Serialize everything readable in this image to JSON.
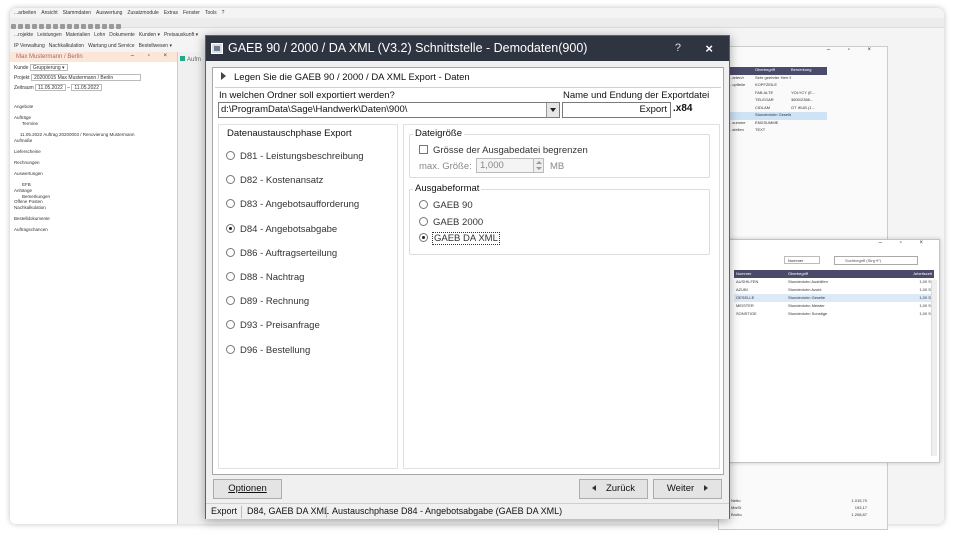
{
  "background": {
    "menubar": [
      "...arbeiten",
      "Ansicht",
      "Stammdaten",
      "Auswertung",
      "Zusatzmodule",
      "Extras",
      "Fenster",
      "Tools",
      "?"
    ],
    "ribbon1": [
      "...rojekte",
      "Leistungen",
      "Materialien",
      "Lohn",
      "Dokumente",
      "Kunden ▾",
      "Preisauskunft ▾"
    ],
    "ribbon2": [
      "IP Verwaltung",
      "Nachkalkulation",
      "Wartung und Service",
      "Bestellwesen ▾"
    ],
    "left_title": "Max Mustermann / Berlin",
    "left_rows": {
      "kunde_label": "Kunde",
      "kunde_value": "Gruppierung ▾",
      "projekt_label": "Projekt",
      "projekt_value": "20200015 Max Mustermann / Berlin",
      "zeitraum_label": "Zeitraum",
      "zeitraum_from": "11.05.2022",
      "zeitraum_to": "11.05.2022"
    },
    "tree": [
      "Angebote",
      "",
      "Aufträge",
      "Termine",
      "",
      "11.05.2022 Auftrag 20200003 / Renovierung Mustermann",
      "Aufmaße",
      "",
      "Lieferscheine",
      "",
      "Rechnungen",
      "",
      "Auswertungen",
      "",
      "EFB",
      "Anhänge",
      "Bemerkungen",
      "Offene Posten",
      "Nachkalkulation",
      "",
      "Bestelldokumente",
      "",
      "Auftragschancen"
    ],
    "mid_tab": "Aufm",
    "rtw_rows": [
      {
        "a": "",
        "b": "Oberbegriff",
        "c": "Bemerkung",
        "hdr": true
      },
      {
        "a": "...arten/r",
        "b": "Sehr geehrter Herr Mu...",
        "c": ""
      },
      {
        "a": "...opfteile",
        "b": "KOPFZEILE",
        "c": ""
      },
      {
        "a": "",
        "b": "FAB ALTE",
        "c": "YOLYCY (E..."
      },
      {
        "a": "",
        "b": "TELEGAR",
        "c": "3600/2366..."
      },
      {
        "a": "",
        "b": "CIDLAM",
        "c": "GT IKUB (1..."
      },
      {
        "a": "",
        "b": "Stundenlohn Geselle",
        "c": "",
        "sel": true
      },
      {
        "a": "...summe",
        "b": "ENDSUMME",
        "c": ""
      },
      {
        "a": "...stellen",
        "b": "TEXT",
        "c": ""
      }
    ],
    "rtw_bottom": [
      {
        "label": "Netto",
        "value": "1.015,70"
      },
      {
        "label": "MwSt",
        "value": "193,17"
      },
      {
        "label": "Brutto",
        "value": "1.208,87"
      }
    ],
    "rbw": {
      "filter_label": "Nummer",
      "search_placeholder": "Suchbegriff (Strg+F)",
      "columns": [
        "Nummer",
        "Oberbegriff",
        "Arbeitszeit"
      ],
      "rows": [
        {
          "n": "AUSHILFEN",
          "o": "Stundenlohn Aushilfen",
          "z": "1,00 St"
        },
        {
          "n": "AZUBI",
          "o": "Stundenlohn Azubi",
          "z": "1,00 St"
        },
        {
          "n": "GESELLE",
          "o": "Stundenlohn Geselle",
          "z": "1,00 St",
          "sel": true
        },
        {
          "n": "MEISTER",
          "o": "Stundenlohn Meister",
          "z": "1,00 St"
        },
        {
          "n": "SONSTIGE",
          "o": "Stundenlohn Sonstige",
          "z": "1,00 St"
        }
      ]
    }
  },
  "dialog": {
    "title": "GAEB 90 / 2000 / DA XML (V3.2) Schnittstelle - Demodaten(900)",
    "help_label": "?",
    "close_label": "×",
    "section_title": "Legen Sie die GAEB 90 / 2000 / DA XML Export - Daten",
    "folder_label": "In welchen Ordner soll exportiert werden?",
    "folder_value": "d:\\ProgramData\\Sage\\Handwerk\\Daten\\900\\",
    "file_label": "Name und Endung der Exportdatei",
    "file_value": "Export",
    "file_ext": ".x84",
    "phase_group_title": "Datenaustauschphase Export",
    "phases": [
      {
        "label": "D81 - Leistungsbeschreibung",
        "checked": false
      },
      {
        "label": "D82 - Kostenansatz",
        "checked": false
      },
      {
        "label": "D83 - Angebotsaufforderung",
        "checked": false
      },
      {
        "label": "D84 - Angebotsabgabe",
        "checked": true
      },
      {
        "label": "D86 - Auftragserteilung",
        "checked": false
      },
      {
        "label": "D88 - Nachtrag",
        "checked": false
      },
      {
        "label": "D89 - Rechnung",
        "checked": false
      },
      {
        "label": "D93 - Preisanfrage",
        "checked": false
      },
      {
        "label": "D96 - Bestellung",
        "checked": false
      }
    ],
    "filesize_title": "Dateigröße",
    "limit_checkbox_label": "Grösse der Ausgabedatei begrenzen",
    "max_size_label": "max. Größe:",
    "max_size_value": "1,000",
    "max_size_unit": "MB",
    "format_title": "Ausgabeformat",
    "formats": [
      {
        "label": "GAEB 90",
        "checked": false
      },
      {
        "label": "GAEB 2000",
        "checked": false
      },
      {
        "label": "GAEB DA XML",
        "checked": true
      }
    ],
    "btn_options": "Optionen",
    "btn_back": "Zurück",
    "btn_next": "Weiter",
    "status": {
      "mode": "Export",
      "format": "D84, GAEB DA XML",
      "phase": "Austauschphase D84 - Angebotsabgabe (GAEB DA XML)"
    }
  }
}
